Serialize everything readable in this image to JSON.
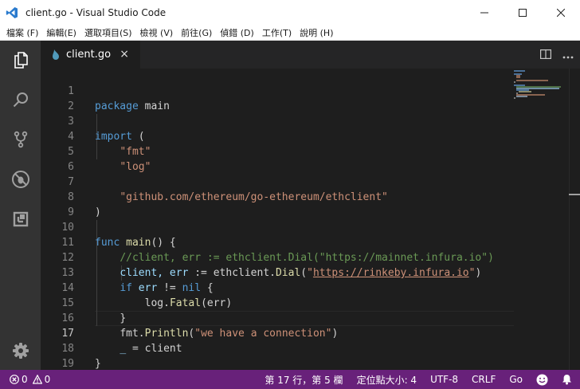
{
  "window": {
    "title": "client.go - Visual Studio Code",
    "minimize_icon": "minimize-icon",
    "maximize_icon": "maximize-icon",
    "close_icon": "close-icon"
  },
  "menu": [
    "檔案 (F)",
    "編輯(E)",
    "選取項目(S)",
    "檢視 (V)",
    "前往(G)",
    "偵錯 (D)",
    "工作(T)",
    "說明 (H)"
  ],
  "activity_bar": [
    "files-icon",
    "search-icon",
    "source-control-icon",
    "debug-icon",
    "extensions-icon",
    "settings-gear-icon"
  ],
  "tab": {
    "label": "client.go",
    "close": "×"
  },
  "editor": {
    "active_line": 17,
    "lines": [
      {
        "n": "1"
      },
      {
        "n": "2"
      },
      {
        "n": "3"
      },
      {
        "n": "4"
      },
      {
        "n": "5"
      },
      {
        "n": "6"
      },
      {
        "n": "7"
      },
      {
        "n": "8"
      },
      {
        "n": "9"
      },
      {
        "n": "10"
      },
      {
        "n": "11"
      },
      {
        "n": "12"
      },
      {
        "n": "13"
      },
      {
        "n": "14"
      },
      {
        "n": "15"
      },
      {
        "n": "16"
      },
      {
        "n": "17"
      },
      {
        "n": "18"
      },
      {
        "n": "19"
      }
    ],
    "tokens": {
      "l1_kw": "package",
      "l1_name": " main",
      "l3_kw": "import",
      "l3_rest": " (",
      "l4": "\"fmt\"",
      "l5": "\"log\"",
      "l7": "\"github.com/ethereum/go-ethereum/ethclient\"",
      "l8": ")",
      "l10_kw": "func",
      "l10_fn": " main",
      "l10_rest": "() {",
      "l11": "//client, err := ethclient.Dial(\"https://mainnet.infura.io\")",
      "l12_vars": "client, err",
      "l12_op": " := ethclient.",
      "l12_fn": "Dial",
      "l12_open": "(",
      "l12_q1": "\"",
      "l12_url": "https://rinkeby.infura.io",
      "l12_q2": "\"",
      "l12_close": ")",
      "l13_kw": "if",
      "l13_var": " err",
      "l13_op": " != ",
      "l13_nil": "nil",
      "l13_rest": " {",
      "l14_pkg": "log.",
      "l14_fn": "Fatal",
      "l14_rest": "(err)",
      "l15": "}",
      "l16_pkg": "fmt.",
      "l16_fn": "Println",
      "l16_open": "(",
      "l16_str": "\"we have a connection\"",
      "l16_close": ")",
      "l17_var": "_",
      "l17_rest": " = client",
      "l18": "}"
    }
  },
  "status_bar": {
    "errors": "0",
    "warnings": "0",
    "position": "第 17 行，第 5 欄",
    "indent": "定位點大小: 4",
    "encoding": "UTF-8",
    "eol": "CRLF",
    "language": "Go",
    "feedback_icon": "smiley-icon",
    "notifications_icon": "bell-icon"
  },
  "colors": {
    "status_bar": "#68217a",
    "activity_bar": "#333333",
    "editor_bg": "#1e1e1e",
    "keyword": "#569cd6",
    "function": "#dcdcaa",
    "string": "#ce9178",
    "variable": "#9cdcfe",
    "comment": "#6a9955"
  }
}
